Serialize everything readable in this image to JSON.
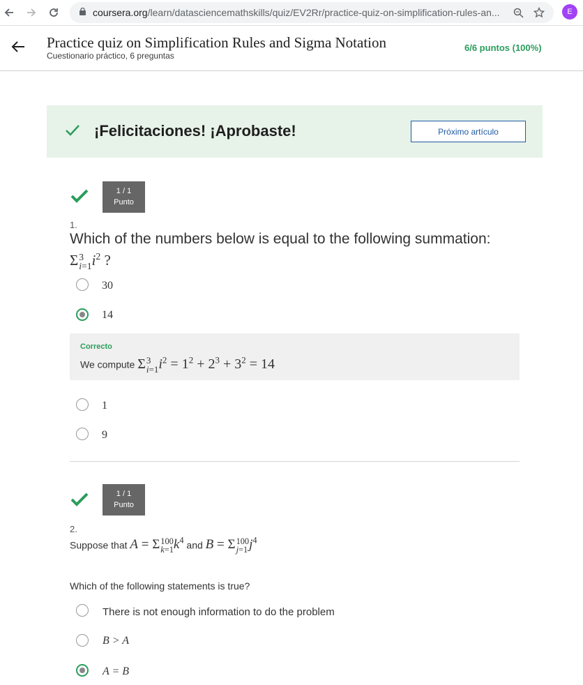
{
  "browser": {
    "url_domain": "coursera.org",
    "url_path": "/learn/datasciencemathskills/quiz/EV2Rr/practice-quiz-on-simplification-rules-an...",
    "profile_initial": "E",
    "profile_color": "#a142f4"
  },
  "header": {
    "title": "Practice quiz on Simplification Rules and Sigma Notation",
    "subtitle": "Cuestionario práctico, 6 preguntas",
    "score": "6/6 puntos (100%)"
  },
  "banner": {
    "message": "¡Felicitaciones! ¡Aprobaste!",
    "next_button": "Próximo artículo"
  },
  "colors": {
    "success": "#2a9d5c",
    "banner_bg": "#e7f2e8",
    "link": "#1f5aa3"
  },
  "questions": [
    {
      "points_line1": "1 / 1",
      "points_line2": "Punto",
      "number": "1.",
      "prompt": "Which of the numbers below is equal to the following summation:",
      "options": [
        {
          "label": "30",
          "selected": false
        },
        {
          "label": "14",
          "selected": true
        },
        {
          "label": "1",
          "selected": false
        },
        {
          "label": "9",
          "selected": false
        }
      ],
      "feedback_label": "Correcto",
      "feedback_text": "We compute"
    },
    {
      "points_line1": "1 / 1",
      "points_line2": "Punto",
      "number": "2.",
      "prompt_pre": "Suppose that",
      "prompt_and": "and",
      "ask": "Which of the following statements is true?",
      "options": [
        {
          "label": "There is not enough information to do the problem",
          "selected": false
        },
        {
          "label": "B > A",
          "selected": false
        },
        {
          "label": "A = B",
          "selected": true
        }
      ]
    }
  ]
}
